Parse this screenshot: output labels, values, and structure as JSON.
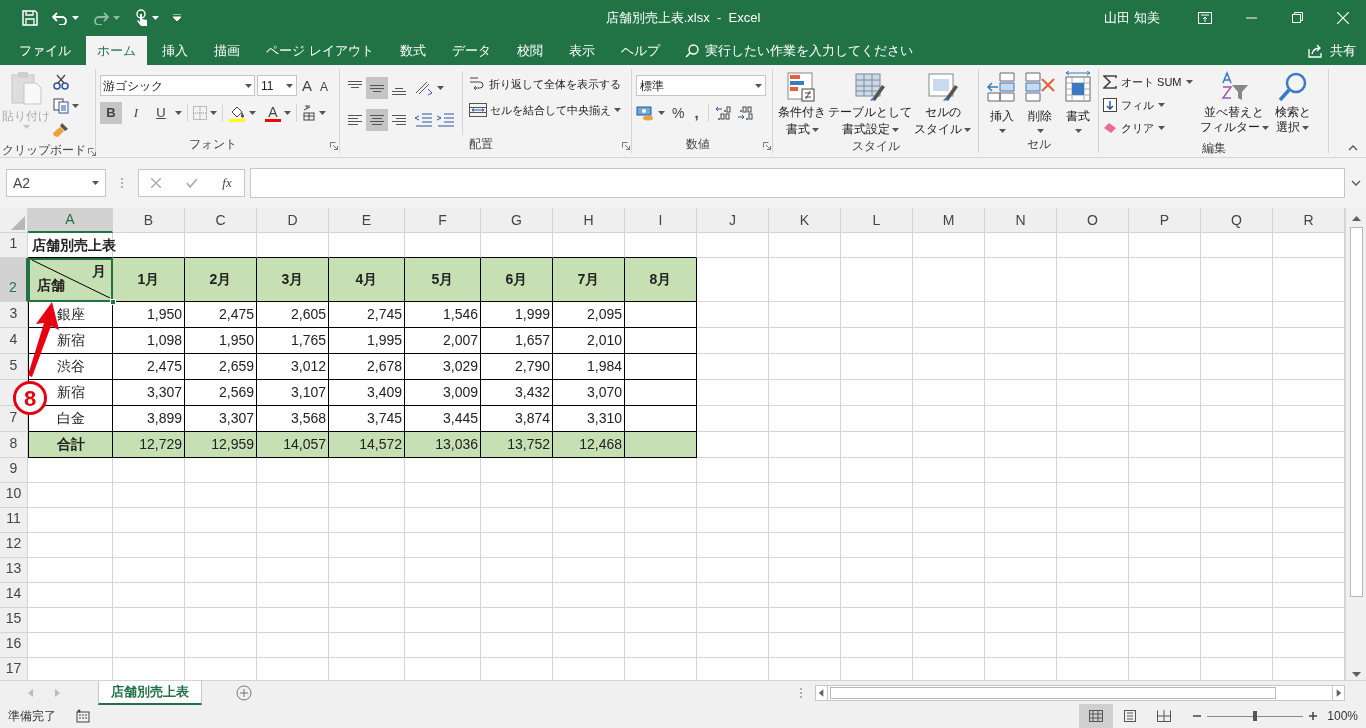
{
  "title_bar": {
    "title": "店舗別売上表.xlsx  -  Excel",
    "user": "山田 知美"
  },
  "tabs": [
    {
      "label": "ファイル",
      "selected": false
    },
    {
      "label": "ホーム",
      "selected": true
    },
    {
      "label": "挿入",
      "selected": false
    },
    {
      "label": "描画",
      "selected": false
    },
    {
      "label": "ページ レイアウト",
      "selected": false
    },
    {
      "label": "数式",
      "selected": false
    },
    {
      "label": "データ",
      "selected": false
    },
    {
      "label": "校閲",
      "selected": false
    },
    {
      "label": "表示",
      "selected": false
    },
    {
      "label": "ヘルプ",
      "selected": false
    }
  ],
  "tell_me": {
    "placeholder": "実行したい作業を入力してください"
  },
  "share": "共有",
  "ribbon": {
    "clipboard": {
      "label": "クリップボード",
      "paste": {
        "label": "貼り付け",
        "disabled": true
      }
    },
    "font": {
      "label": "フォント",
      "name": "游ゴシック",
      "size": "11",
      "grow": "A",
      "shrink": "A",
      "bold": {
        "label": "B",
        "selected": true
      },
      "italic": {
        "label": "I",
        "selected": false
      },
      "underline": {
        "label": "U",
        "selected": false
      },
      "color_button": "A"
    },
    "alignment": {
      "label": "配置",
      "buttons": [
        {
          "kind": "top",
          "selected": false
        },
        {
          "kind": "middle",
          "selected": true
        },
        {
          "kind": "bottom",
          "selected": false
        },
        {
          "kind": "left",
          "selected": false
        },
        {
          "kind": "center",
          "selected": true
        },
        {
          "kind": "right",
          "selected": false
        }
      ],
      "wrap": "折り返して全体を表示する",
      "merge": "セルを結合して中央揃え"
    },
    "number": {
      "label": "数値",
      "format": "標準",
      "percent": "%",
      "comma": ","
    },
    "styles": {
      "label": "スタイル",
      "buttons": [
        {
          "kind": "conditional",
          "lines": [
            "条件付き",
            "書式"
          ]
        },
        {
          "kind": "table",
          "lines": [
            "テーブルとして",
            "書式設定"
          ]
        },
        {
          "kind": "cell_styles",
          "lines": [
            "セルの",
            "スタイル"
          ]
        }
      ]
    },
    "cells": {
      "label": "セル",
      "buttons": [
        {
          "kind": "insert",
          "label": "挿入"
        },
        {
          "kind": "delete",
          "label": "削除"
        },
        {
          "kind": "format",
          "label": "書式"
        }
      ]
    },
    "editing": {
      "label": "編集",
      "autosum": "オート SUM",
      "fill": "フィル",
      "clear": "クリア",
      "sort": [
        "並べ替えと",
        "フィルター"
      ],
      "find": [
        "検索と",
        "選択"
      ]
    }
  },
  "formula_bar": {
    "name_box": "A2",
    "function_label": "fx"
  },
  "sheet": {
    "columns": [
      {
        "label": "A",
        "selected": true
      },
      {
        "label": "B",
        "selected": false
      },
      {
        "label": "C",
        "selected": false
      },
      {
        "label": "D",
        "selected": false
      },
      {
        "label": "E",
        "selected": false
      },
      {
        "label": "F",
        "selected": false
      },
      {
        "label": "G",
        "selected": false
      },
      {
        "label": "H",
        "selected": false
      },
      {
        "label": "I",
        "selected": false
      },
      {
        "label": "J",
        "selected": false
      },
      {
        "label": "K",
        "selected": false
      },
      {
        "label": "L",
        "selected": false
      },
      {
        "label": "M",
        "selected": false
      },
      {
        "label": "N",
        "selected": false
      },
      {
        "label": "O",
        "selected": false
      },
      {
        "label": "P",
        "selected": false
      },
      {
        "label": "Q",
        "selected": false
      },
      {
        "label": "R",
        "selected": false
      }
    ],
    "rows": [
      {
        "kind": "title",
        "number": "1",
        "selected": false,
        "cells": [
          "店舗別売上表"
        ]
      },
      {
        "kind": "header",
        "number": "2",
        "selected": true,
        "corner": {
          "top": "月",
          "bottom": "店舗"
        },
        "cells": [
          "1月",
          "2月",
          "3月",
          "4月",
          "5月",
          "6月",
          "7月",
          "8月"
        ]
      },
      {
        "kind": "data",
        "number": "3",
        "selected": false,
        "cells": [
          "銀座",
          "1,950",
          "2,475",
          "2,605",
          "2,745",
          "1,546",
          "1,999",
          "2,095"
        ]
      },
      {
        "kind": "data",
        "number": "4",
        "selected": false,
        "cells": [
          "新宿",
          "1,098",
          "1,950",
          "1,765",
          "1,995",
          "2,007",
          "1,657",
          "2,010"
        ]
      },
      {
        "kind": "data",
        "number": "5",
        "selected": false,
        "cells": [
          "渋谷",
          "2,475",
          "2,659",
          "3,012",
          "2,678",
          "3,029",
          "2,790",
          "1,984"
        ]
      },
      {
        "kind": "data",
        "selected": false,
        "cells": [
          "新宿",
          "3,307",
          "2,569",
          "3,107",
          "3,409",
          "3,009",
          "3,432",
          "3,070"
        ]
      },
      {
        "kind": "data",
        "number": "7",
        "selected": false,
        "cells": [
          "白金",
          "3,899",
          "3,307",
          "3,568",
          "3,745",
          "3,445",
          "3,874",
          "3,310"
        ]
      },
      {
        "kind": "total",
        "number": "8",
        "selected": false,
        "cells": [
          "合計",
          "12,729",
          "12,959",
          "14,057",
          "14,572",
          "13,036",
          "13,752",
          "12,468"
        ]
      },
      {
        "kind": "empty",
        "number": "9",
        "selected": false
      },
      {
        "kind": "empty",
        "number": "10",
        "selected": false
      },
      {
        "kind": "empty",
        "number": "11",
        "selected": false
      },
      {
        "kind": "empty",
        "number": "12",
        "selected": false
      },
      {
        "kind": "empty",
        "number": "13",
        "selected": false
      },
      {
        "kind": "empty",
        "number": "14",
        "selected": false
      },
      {
        "kind": "empty",
        "number": "15",
        "selected": false
      },
      {
        "kind": "empty",
        "number": "16",
        "selected": false
      },
      {
        "kind": "empty",
        "number": "17",
        "selected": false
      }
    ]
  },
  "annotation": {
    "label": "8"
  },
  "sheet_tabs": [
    {
      "label": "店舗別売上表",
      "selected": true
    }
  ],
  "status_bar": {
    "status": "準備完了",
    "views": [
      {
        "kind": "normal",
        "selected": true
      },
      {
        "kind": "page_layout",
        "selected": false
      },
      {
        "kind": "page_break",
        "selected": false
      }
    ],
    "zoom": {
      "level": 0.5,
      "reading": "100%"
    }
  }
}
